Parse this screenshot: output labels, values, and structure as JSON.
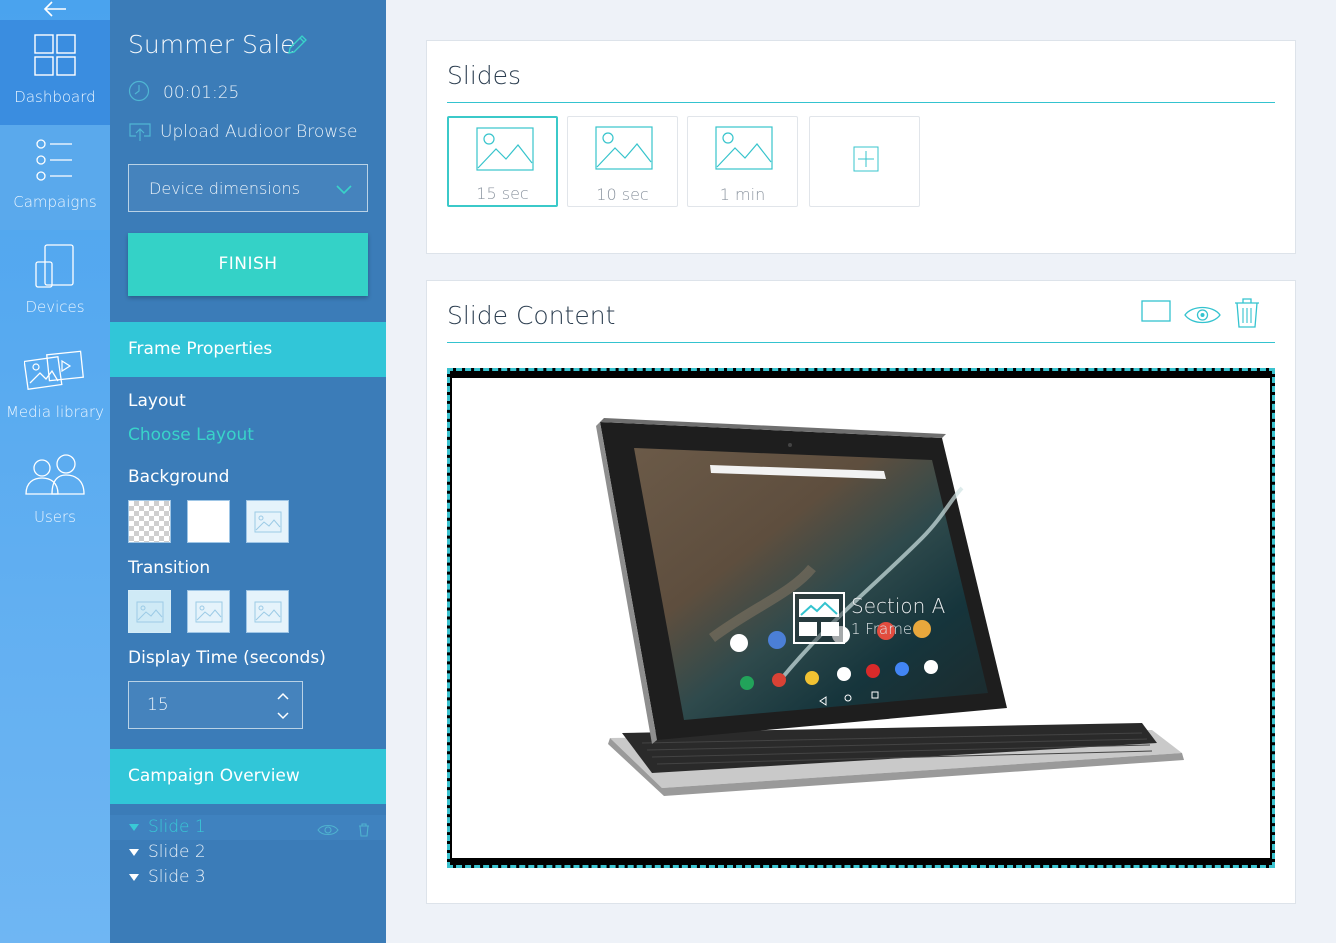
{
  "nav": {
    "back_icon": "arrow-left-icon",
    "items": [
      {
        "label": "Dashboard",
        "icon": "grid-icon"
      },
      {
        "label": "Campaigns",
        "icon": "list-icon"
      },
      {
        "label": "Devices",
        "icon": "devices-icon"
      },
      {
        "label": "Media library",
        "icon": "images-icon"
      },
      {
        "label": "Users",
        "icon": "users-icon"
      }
    ]
  },
  "campaign": {
    "title": "Summer Sale",
    "duration": "00:01:25",
    "upload_audio": "Upload Audio",
    "browse": "or Browse",
    "dimensions_select": "Device dimensions",
    "finish_label": "FINISH"
  },
  "frame": {
    "header": "Frame Properties",
    "layout_label": "Layout",
    "choose_layout": "Choose Layout",
    "background_label": "Background",
    "transition_label": "Transition",
    "display_time_label": "Display Time (seconds)",
    "display_time_value": "15"
  },
  "overview": {
    "header": "Campaign Overview",
    "slides": [
      "Slide 1",
      "Slide 2",
      "Slide 3"
    ]
  },
  "slides_card": {
    "title": "Slides",
    "thumbs": [
      "15 sec",
      "10 sec",
      "1 min"
    ]
  },
  "content_card": {
    "title": "Slide Content",
    "section_name": "Section A",
    "section_sub": "1 Frame"
  },
  "colors": {
    "accent": "#34d2c7",
    "panel": "#3b7cb8",
    "nav": "#4aa3ee",
    "section_header": "#31c6d8"
  }
}
